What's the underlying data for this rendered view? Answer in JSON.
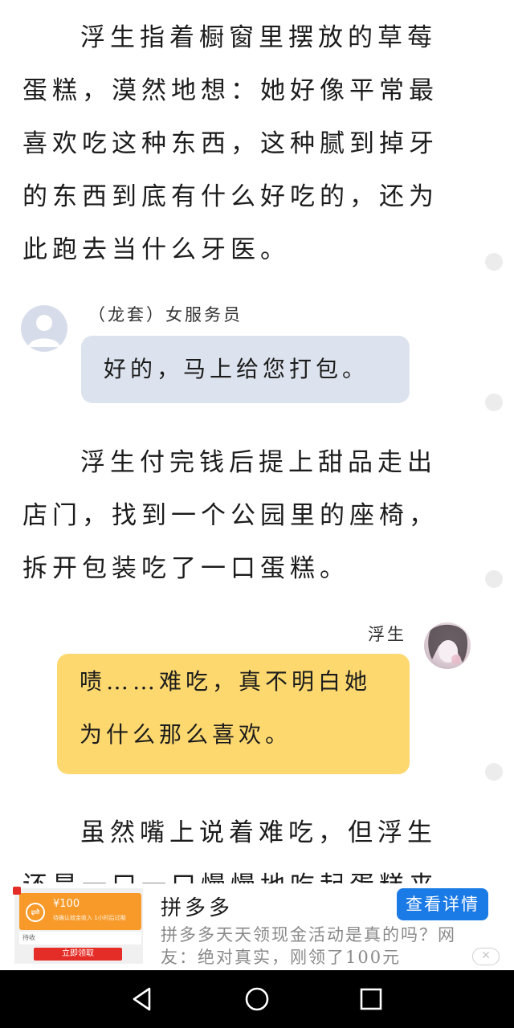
{
  "reader": {
    "paragraph_1": "浮生指着橱窗里摆放的草莓蛋糕，漠然地想：她好像平常最喜欢吃这种东西，这种腻到掉牙的东西到底有什么好吃的，还为此跑去当什么牙医。",
    "dialogue_1": {
      "speaker": "（龙套）女服务员",
      "text": "好的，马上给您打包。",
      "avatar_icon": "default-user-avatar"
    },
    "paragraph_2": "浮生付完钱后提上甜品走出店门，找到一个公园里的座椅，拆开包装吃了一口蛋糕。",
    "dialogue_2": {
      "speaker": "浮生",
      "text": "啧……难吃，真不明白她为什么那么喜欢。",
      "avatar_icon": "character-avatar"
    },
    "paragraph_3": "虽然嘴上说着难吃，但浮生还是一口一口慢慢地吃起蛋糕来了。"
  },
  "ad": {
    "thumb_amount": "¥100",
    "thumb_sub": "待确认就金收入 1小时后过期",
    "thumb_mid": "待收",
    "thumb_button": "立即领取",
    "title": "拼多多",
    "description": "拼多多天天领现金活动是真的吗？网友：绝对真实，刚领了100元",
    "cta_label": "查看详情",
    "close_label": "✕"
  },
  "colors": {
    "gray_bubble": "#dde3ee",
    "yellow_bubble": "#fcd86f",
    "ad_cta": "#1a7ae6",
    "navbar": "#000000"
  }
}
